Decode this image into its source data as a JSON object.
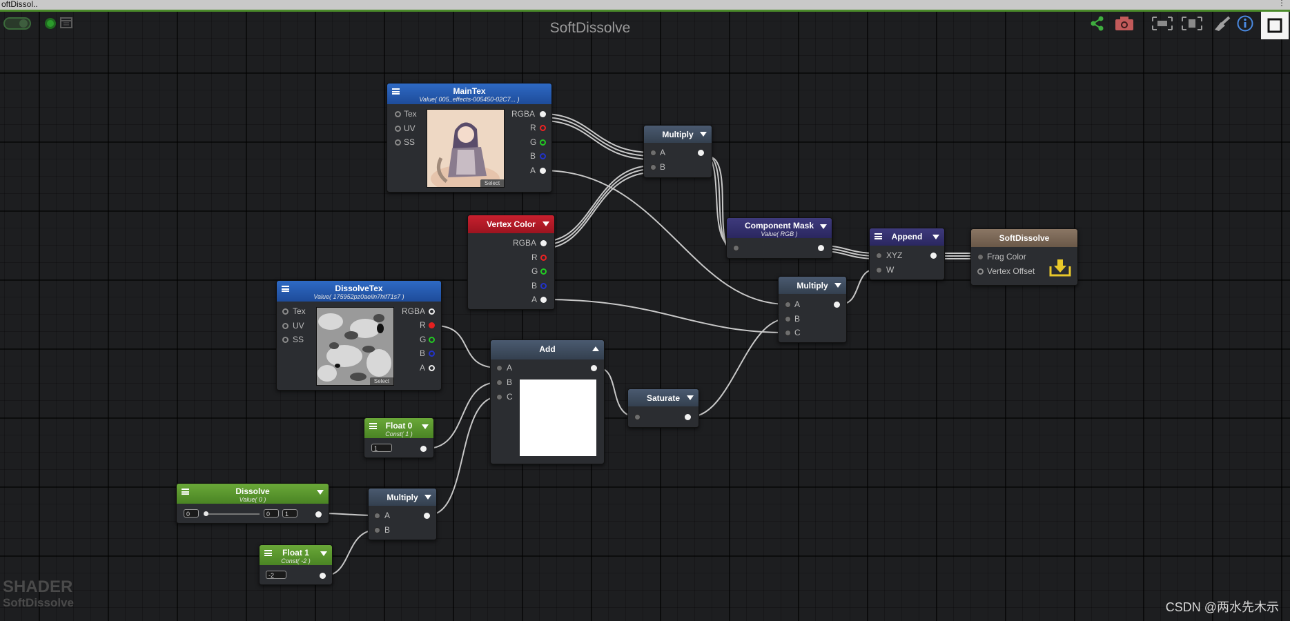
{
  "window": {
    "tab_title": "oftDissol..",
    "canvas_title": "SoftDissolve",
    "menu_dots": "⋮"
  },
  "toolbar": {
    "left_icons": [
      "live-toggle-icon",
      "status-light-icon",
      "graph-icon"
    ],
    "right_icons": [
      "share-icon",
      "camera-icon",
      "focus-icon",
      "fit-view-icon",
      "clean-icon",
      "info-icon",
      "maximize-icon"
    ]
  },
  "nodes": {
    "maintex": {
      "title": "MainTex",
      "subtitle": "Value( 005_effects-005450-02C7... )",
      "inputs": [
        "Tex",
        "UV",
        "SS"
      ],
      "outputs": [
        "RGBA",
        "R",
        "G",
        "B",
        "A"
      ],
      "select_label": "Select"
    },
    "multiply_top": {
      "title": "Multiply",
      "inputs": [
        "A",
        "B"
      ]
    },
    "vertex_color": {
      "title": "Vertex Color",
      "outputs": [
        "RGBA",
        "R",
        "G",
        "B",
        "A"
      ]
    },
    "component_mask": {
      "title": "Component Mask",
      "subtitle": "Value( RGB )"
    },
    "append": {
      "title": "Append",
      "inputs": [
        "XYZ",
        "W"
      ]
    },
    "output": {
      "title": "SoftDissolve",
      "inputs": [
        "Frag Color",
        "Vertex Offset"
      ]
    },
    "dissolvetex": {
      "title": "DissolveTex",
      "subtitle": "Value( 175952pz0aeiln7hif71s7 )",
      "inputs": [
        "Tex",
        "UV",
        "SS"
      ],
      "outputs": [
        "RGBA",
        "R",
        "G",
        "B",
        "A"
      ],
      "select_label": "Select"
    },
    "multiply_mid": {
      "title": "Multiply",
      "inputs": [
        "A",
        "B",
        "C"
      ]
    },
    "add": {
      "title": "Add",
      "inputs": [
        "A",
        "B",
        "C"
      ]
    },
    "saturate": {
      "title": "Saturate"
    },
    "float0": {
      "title": "Float 0",
      "subtitle": "Const( 1 )",
      "value": "1"
    },
    "dissolve": {
      "title": "Dissolve",
      "subtitle": "Value( 0 )",
      "value": "0",
      "min": "0",
      "max": "1",
      "slider_fraction": 0
    },
    "multiply_bot": {
      "title": "Multiply",
      "inputs": [
        "A",
        "B"
      ]
    },
    "float1": {
      "title": "Float 1",
      "subtitle": "Const( -2 )",
      "value": "-2"
    }
  },
  "footer": {
    "shader_label": "SHADER",
    "shader_name": "SoftDissolve",
    "watermark": "CSDN @两水先木示"
  },
  "colors": {
    "accent_green": "#4a8a2a",
    "property_blue": "#2e6ac4",
    "vertex_red": "#c8202e"
  }
}
